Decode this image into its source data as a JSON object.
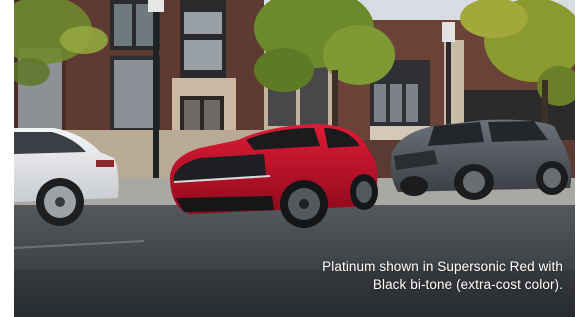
{
  "photo": {
    "subject": "Three cars parked on a street in front of a brick building",
    "colors": {
      "sky": "#d7dde2",
      "brick": "#6a4238",
      "asphalt": "#3f4246",
      "red_car": "#c8102e",
      "silver_car": "#e9eaec",
      "gray_suv": "#5a5f66",
      "foliage": "#6f8a2e"
    }
  },
  "caption": {
    "line1": "Platinum shown in Supersonic Red with",
    "line2": "Black bi-tone (extra-cost color)."
  }
}
